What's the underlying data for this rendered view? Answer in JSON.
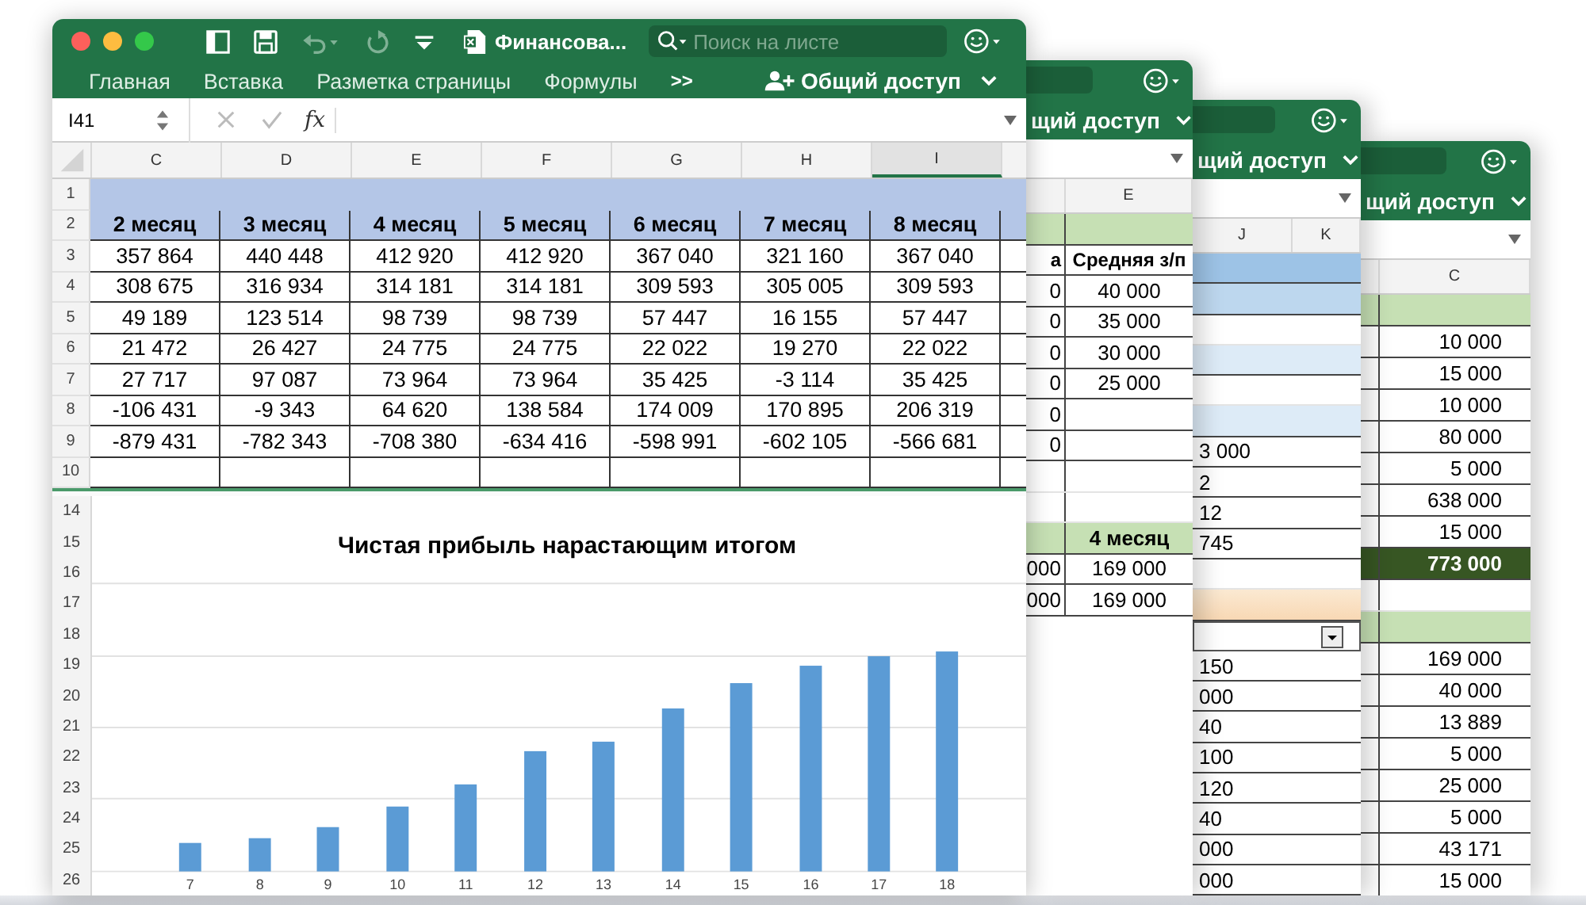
{
  "front_window": {
    "title": "Финансова...",
    "search": {
      "placeholder": "Поиск на листе"
    },
    "tabs": [
      "Главная",
      "Вставка",
      "Разметка страницы",
      "Формулы"
    ],
    "overflow": ">>",
    "share_label": "Общий доступ",
    "name_box": "I41",
    "formula_label": "fx",
    "columns": [
      {
        "label": "C",
        "selected": false
      },
      {
        "label": "D",
        "selected": false
      },
      {
        "label": "E",
        "selected": false
      },
      {
        "label": "F",
        "selected": false
      },
      {
        "label": "G",
        "selected": false
      },
      {
        "label": "H",
        "selected": false
      },
      {
        "label": "I",
        "selected": true
      }
    ],
    "rows": [
      {
        "number": "1",
        "kind": "band"
      },
      {
        "number": "2",
        "kind": "header",
        "cells": [
          "2 месяц",
          "3 месяц",
          "4 месяц",
          "5 месяц",
          "6 месяц",
          "7 месяц",
          "8 месяц"
        ]
      },
      {
        "number": "3",
        "kind": "data",
        "cells": [
          "357 864",
          "440 448",
          "412 920",
          "412 920",
          "367 040",
          "321 160",
          "367 040"
        ]
      },
      {
        "number": "4",
        "kind": "data",
        "cells": [
          "308 675",
          "316 934",
          "314 181",
          "314 181",
          "309 593",
          "305 005",
          "309 593"
        ]
      },
      {
        "number": "5",
        "kind": "data",
        "cells": [
          "49 189",
          "123 514",
          "98 739",
          "98 739",
          "57 447",
          "16 155",
          "57 447"
        ]
      },
      {
        "number": "6",
        "kind": "data",
        "cells": [
          "21 472",
          "26 427",
          "24 775",
          "24 775",
          "22 022",
          "19 270",
          "22 022"
        ]
      },
      {
        "number": "7",
        "kind": "data",
        "cells": [
          "27 717",
          "97 087",
          "73 964",
          "73 964",
          "35 425",
          "-3 114",
          "35 425"
        ]
      },
      {
        "number": "8",
        "kind": "data",
        "cells": [
          "-106 431",
          "-9 343",
          "64 620",
          "138 584",
          "174 009",
          "170 895",
          "206 319"
        ]
      },
      {
        "number": "9",
        "kind": "data",
        "cells": [
          "-879 431",
          "-782 343",
          "-708 380",
          "-634 416",
          "-598 991",
          "-602 105",
          "-566 681"
        ]
      },
      {
        "number": "10",
        "kind": "empty"
      }
    ],
    "chart_rows": [
      "14",
      "15",
      "16",
      "17",
      "18",
      "19",
      "20",
      "21",
      "22",
      "23",
      "24",
      "25",
      "26"
    ],
    "chart": {
      "title": "Чистая прибыль нарастающим итогом",
      "x_labels": [
        "7",
        "8",
        "9",
        "10",
        "11",
        "12",
        "13",
        "14",
        "15",
        "16",
        "17",
        "18"
      ]
    }
  },
  "back_windows": [
    {
      "share_label": "щий доступ",
      "columns": [
        "E"
      ],
      "rows": [
        {
          "kind": "header"
        },
        {
          "kind": "label",
          "lead": "а",
          "value": "Средняя з/п"
        },
        {
          "kind": "data",
          "lead": "0",
          "value": "40 000"
        },
        {
          "kind": "data",
          "lead": "0",
          "value": "35 000"
        },
        {
          "kind": "data",
          "lead": "0",
          "value": "30 000"
        },
        {
          "kind": "data",
          "lead": "0",
          "value": "25 000"
        },
        {
          "kind": "data",
          "lead": "0"
        },
        {
          "kind": "data",
          "lead": "0"
        },
        {
          "kind": "blank"
        },
        {
          "kind": "blank"
        },
        {
          "kind": "header",
          "value": "4 месяц"
        },
        {
          "kind": "data",
          "lead": "000",
          "value": "169 000"
        },
        {
          "kind": "data",
          "lead": "000",
          "value": "169 000"
        }
      ]
    },
    {
      "share_label": "щий доступ",
      "columns": [
        "J",
        "K"
      ],
      "rows": [
        {
          "kind": "band"
        },
        {
          "kind": "band_light"
        },
        {
          "kind": "blank"
        },
        {
          "kind": "band_pale"
        },
        {
          "kind": "blank"
        },
        {
          "kind": "band_pale"
        },
        {
          "kind": "data",
          "value": "3 000"
        },
        {
          "kind": "data",
          "value": "2"
        },
        {
          "kind": "data",
          "value": "12"
        },
        {
          "kind": "data",
          "value": "745"
        },
        {
          "kind": "blank"
        },
        {
          "kind": "input"
        },
        {
          "kind": "dropdown"
        },
        {
          "kind": "data",
          "value": "150"
        },
        {
          "kind": "data",
          "value": "000"
        },
        {
          "kind": "data",
          "value": "40"
        },
        {
          "kind": "data",
          "value": "100"
        },
        {
          "kind": "data",
          "value": "120"
        },
        {
          "kind": "data",
          "value": "40"
        },
        {
          "kind": "data",
          "value": "000"
        },
        {
          "kind": "data",
          "value": "000"
        }
      ]
    },
    {
      "share_label": "щий доступ",
      "columns": [
        "C"
      ],
      "rows": [
        {
          "kind": "header"
        },
        {
          "kind": "data",
          "value": "10 000"
        },
        {
          "kind": "data",
          "value": "15 000"
        },
        {
          "kind": "data",
          "value": "10 000"
        },
        {
          "kind": "data",
          "value": "80 000"
        },
        {
          "kind": "data",
          "value": "5 000"
        },
        {
          "kind": "data",
          "value": "638 000"
        },
        {
          "kind": "data",
          "value": "15 000"
        },
        {
          "kind": "total",
          "value": "773 000"
        },
        {
          "kind": "blank"
        },
        {
          "kind": "header"
        },
        {
          "kind": "data",
          "value": "169 000"
        },
        {
          "kind": "data",
          "value": "40 000"
        },
        {
          "kind": "data",
          "value": "13 889"
        },
        {
          "kind": "data",
          "value": "5 000"
        },
        {
          "kind": "data",
          "value": "25 000"
        },
        {
          "kind": "data",
          "value": "5 000"
        },
        {
          "kind": "data",
          "value": "43 171"
        },
        {
          "kind": "data",
          "value": "15 000"
        }
      ]
    }
  ]
}
